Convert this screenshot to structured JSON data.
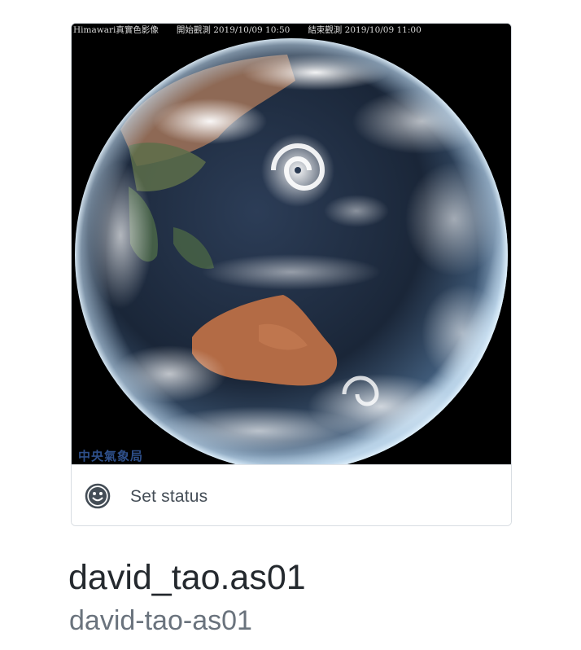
{
  "avatar": {
    "caption_source": "Himawari真實色影像",
    "caption_start": "開始觀測 2019/10/09 10:50",
    "caption_end": "結束觀測 2019/10/09 11:00",
    "watermark": "中央氣象局"
  },
  "status": {
    "icon": "smiley-icon",
    "label": "Set status"
  },
  "profile": {
    "full_name": "david_tao.as01",
    "username": "david-tao-as01"
  },
  "colors": {
    "name_text": "#24292e",
    "username_text": "#6a737d",
    "status_text": "#444d56",
    "border": "#d8dde2"
  }
}
